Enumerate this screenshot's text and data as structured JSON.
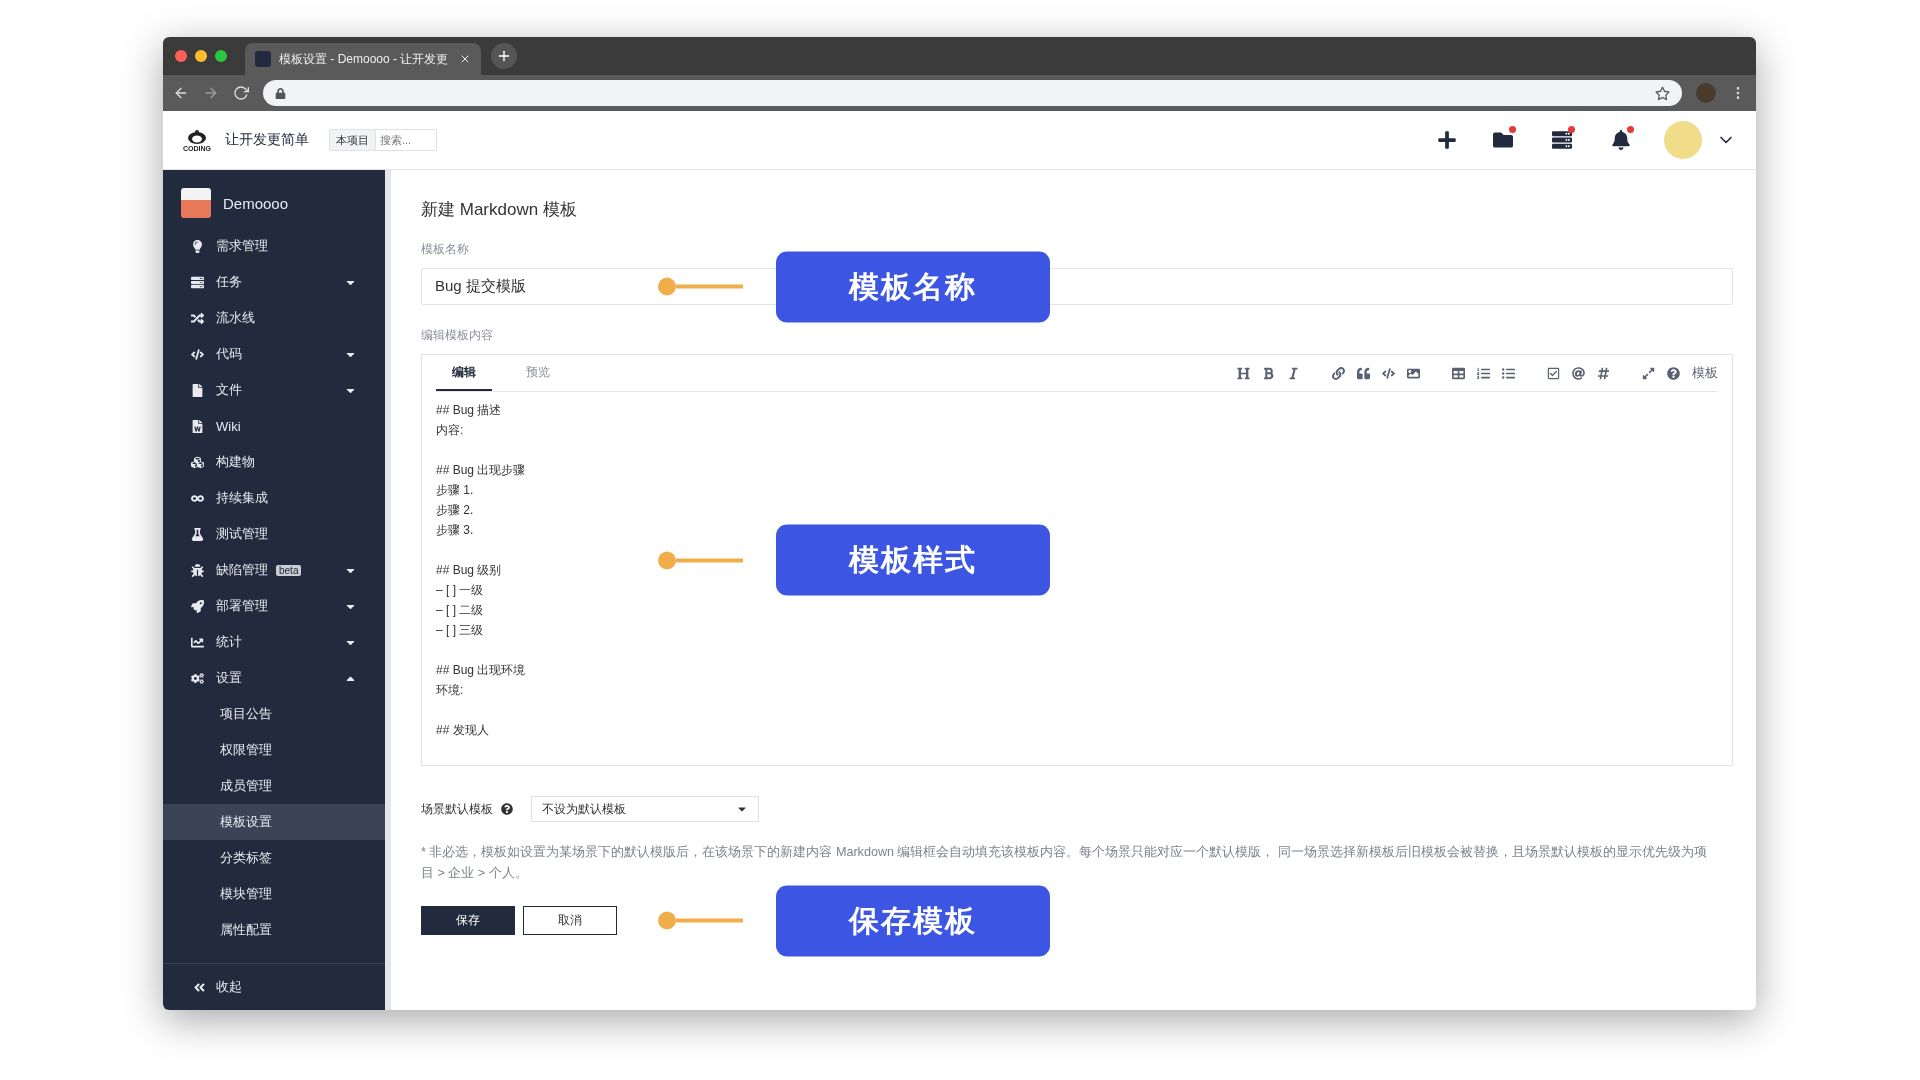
{
  "browser": {
    "tab_title": "模板设置 - Demoooo - 让开发更"
  },
  "header": {
    "brand": "让开发更简单",
    "logo_text": "CODING",
    "search_scope": "本项目",
    "search_placeholder": "搜索...",
    "icons": [
      {
        "kind": "plus",
        "notification": false
      },
      {
        "kind": "folder",
        "notification": true
      },
      {
        "kind": "list",
        "notification": true
      },
      {
        "kind": "bell",
        "notification": true
      }
    ]
  },
  "sidebar": {
    "project": "Demoooo",
    "collapse": "收起",
    "items": [
      {
        "label": "需求管理",
        "kind": "plain"
      },
      {
        "label": "任务",
        "kind": "group",
        "expanded": false
      },
      {
        "label": "流水线",
        "kind": "plain"
      },
      {
        "label": "代码",
        "kind": "group",
        "expanded": false
      },
      {
        "label": "文件",
        "kind": "group",
        "expanded": false
      },
      {
        "label": "Wiki",
        "kind": "plain"
      },
      {
        "label": "构建物",
        "kind": "plain"
      },
      {
        "label": "持续集成",
        "kind": "plain"
      },
      {
        "label": "测试管理",
        "kind": "plain"
      },
      {
        "label": "缺陷管理",
        "kind": "group",
        "expanded": false,
        "badge": "beta"
      },
      {
        "label": "部署管理",
        "kind": "group",
        "expanded": false
      },
      {
        "label": "统计",
        "kind": "group",
        "expanded": false
      },
      {
        "label": "设置",
        "kind": "group",
        "expanded": true,
        "children": [
          {
            "label": "项目公告",
            "selected": false
          },
          {
            "label": "权限管理",
            "selected": false
          },
          {
            "label": "成员管理",
            "selected": false
          },
          {
            "label": "模板设置",
            "selected": true
          },
          {
            "label": "分类标签",
            "selected": false
          },
          {
            "label": "模块管理",
            "selected": false
          },
          {
            "label": "属性配置",
            "selected": false
          }
        ]
      }
    ]
  },
  "form": {
    "title": "新建 Markdown 模板",
    "name_label": "模板名称",
    "name_value": "Bug 提交模版",
    "content_label": "编辑模板内容",
    "editor_tabs": [
      {
        "label": "编辑",
        "selected": true
      },
      {
        "label": "预览",
        "selected": false
      }
    ],
    "toolbar_template": "模板",
    "content": [
      [
        "## Bug 描述",
        "内容:"
      ],
      [
        "## Bug 出现步骤",
        "步骤 1.",
        "步骤 2.",
        "步骤 3."
      ],
      [
        "## Bug 级别",
        "– [ ] 一级",
        "– [ ] 二级",
        "– [ ] 三级"
      ],
      [
        "## Bug 出现环境",
        "环境:"
      ],
      [
        "## 发现人"
      ]
    ],
    "scene_label": "场景默认模板",
    "scene_value": "不设为默认模板",
    "note": "* 非必选，模板如设置为某场景下的默认模版后，在该场景下的新建内容 Markdown 编辑框会自动填充该模板内容。每个场景只能对应一个默认模版， 同一场景选择新模板后旧模板会被替换，且场景默认模板的显示优先级为项目 > 企业 > 个人。",
    "save": "保存",
    "cancel": "取消"
  },
  "callouts": [
    "模板名称",
    "模板样式",
    "保存模板"
  ]
}
